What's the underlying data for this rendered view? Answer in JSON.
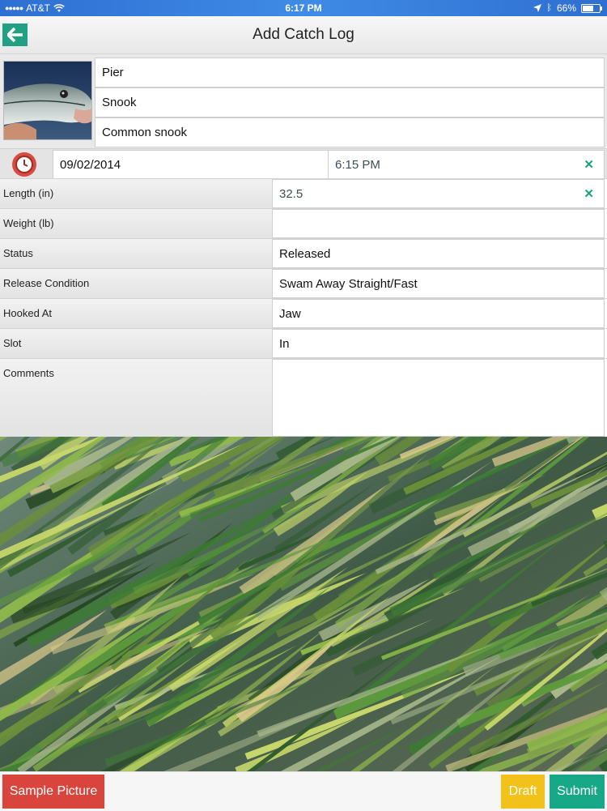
{
  "status_bar": {
    "carrier": "AT&T",
    "time": "6:17 PM",
    "battery": "66%",
    "battery_level": 0.66
  },
  "header": {
    "title": "Add Catch Log"
  },
  "catch": {
    "location": "Pier",
    "species": "Snook",
    "common_name": "Common snook",
    "date": "09/02/2014",
    "time": "6:15 PM"
  },
  "form": {
    "length": {
      "label": "Length (in)",
      "value": "32.5"
    },
    "weight": {
      "label": "Weight (lb)",
      "value": ""
    },
    "status": {
      "label": "Status",
      "value": "Released"
    },
    "release_condition": {
      "label": "Release Condition",
      "value": "Swam Away Straight/Fast"
    },
    "hooked_at": {
      "label": "Hooked At",
      "value": "Jaw"
    },
    "slot": {
      "label": "Slot",
      "value": "In"
    },
    "comments": {
      "label": "Comments",
      "value": ""
    }
  },
  "buttons": {
    "sample_picture": "Sample Picture",
    "draft": "Draft",
    "submit": "Submit"
  },
  "icons": {
    "back": "back-arrow-icon",
    "clock": "clock-icon",
    "clear": "clear-icon"
  },
  "colors": {
    "accent": "#20a184",
    "danger": "#d9453d",
    "warning": "#f2c21b",
    "status_bar": "#3a80df"
  }
}
